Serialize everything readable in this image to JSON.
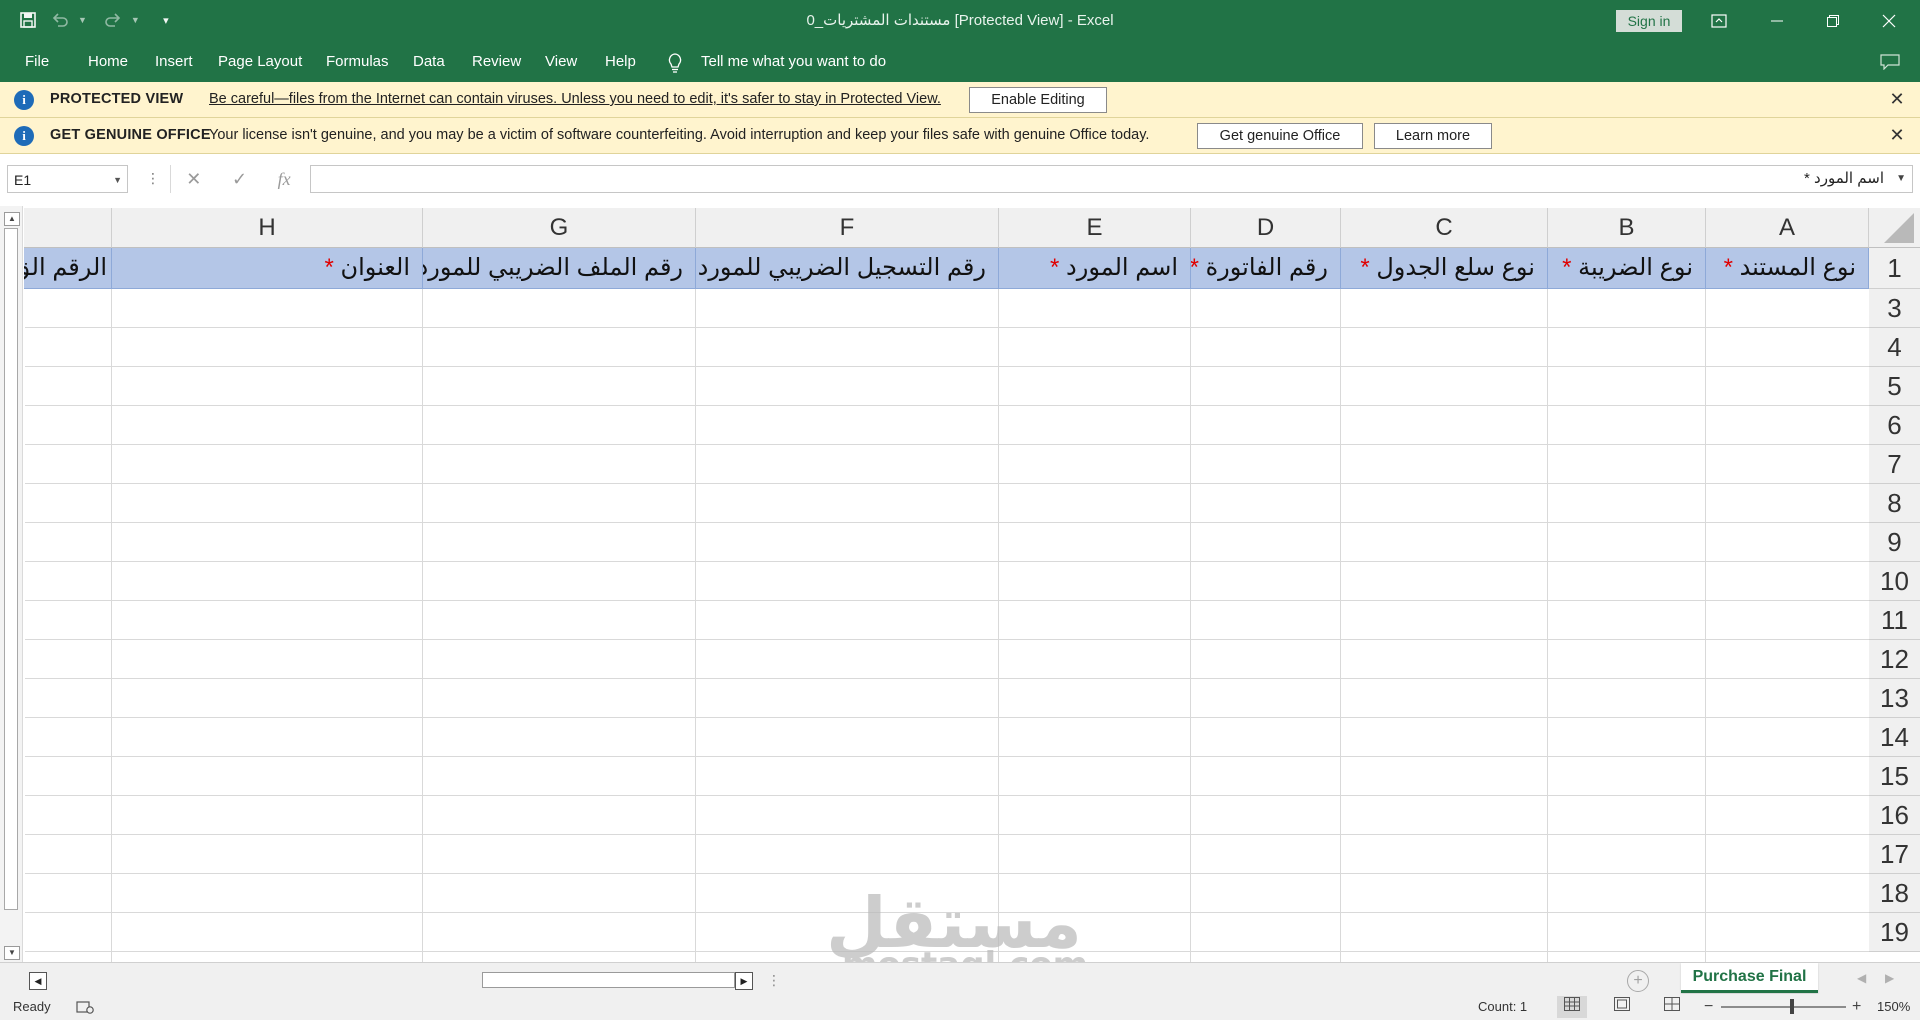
{
  "titlebar": {
    "title": "مستندات المشتريات_0  [Protected View]  -  Excel",
    "sign_in": "Sign in",
    "undo_icon": "undo-icon",
    "redo_icon": "redo-icon",
    "save_icon": "save-icon"
  },
  "menu": {
    "file": "File",
    "home": "Home",
    "insert": "Insert",
    "page_layout": "Page Layout",
    "formulas": "Formulas",
    "data": "Data",
    "review": "Review",
    "view": "View",
    "help": "Help",
    "tell_me": "Tell me what you want to do"
  },
  "protected_view": {
    "title": "PROTECTED VIEW",
    "message": "Be careful—files from the Internet can contain viruses. Unless you need to edit, it's safer to stay in Protected View.",
    "button": "Enable Editing"
  },
  "genuine_office": {
    "title": "GET GENUINE OFFICE",
    "message": "Your license isn't genuine, and you may be a victim of software counterfeiting. Avoid interruption and keep your files safe with genuine Office today.",
    "button_primary": "Get genuine Office",
    "button_secondary": "Learn more"
  },
  "formula_bar": {
    "name_box": "E1",
    "fx": "fx",
    "value": "اسم المورد *"
  },
  "columns": [
    "A",
    "B",
    "C",
    "D",
    "E",
    "F",
    "G",
    "H"
  ],
  "rows": [
    "1",
    "3",
    "4",
    "5",
    "6",
    "7",
    "8",
    "9",
    "10",
    "11",
    "12",
    "13",
    "14",
    "15",
    "16",
    "17",
    "18",
    "19"
  ],
  "header_row": [
    {
      "text": "نوع المستند",
      "star": "*"
    },
    {
      "text": "نوع الضريبة",
      "star": "*"
    },
    {
      "text": "نوع سلع الجدول",
      "star": "*"
    },
    {
      "text": "رقم الفاتورة",
      "star": "*"
    },
    {
      "text": "اسم المورد",
      "star": "*"
    },
    {
      "text": "رقم التسجيل الضريبي للمورد",
      "star": ""
    },
    {
      "text": "رقم الملف الضريبي للمورد",
      "star": ""
    },
    {
      "text": "العنوان",
      "star": "*"
    },
    {
      "text": "الرقم الق",
      "star": ""
    }
  ],
  "sheet_tab": "Purchase Final",
  "status": {
    "ready": "Ready",
    "count": "Count: 1",
    "zoom": "150%"
  },
  "watermark": {
    "arabic": "مستقل",
    "latin": "mostaql.com"
  },
  "colors": {
    "excel_green": "#217346",
    "header_fill": "#b4c6e7",
    "message_bar": "#fff4ce",
    "required_star": "#e00000"
  }
}
